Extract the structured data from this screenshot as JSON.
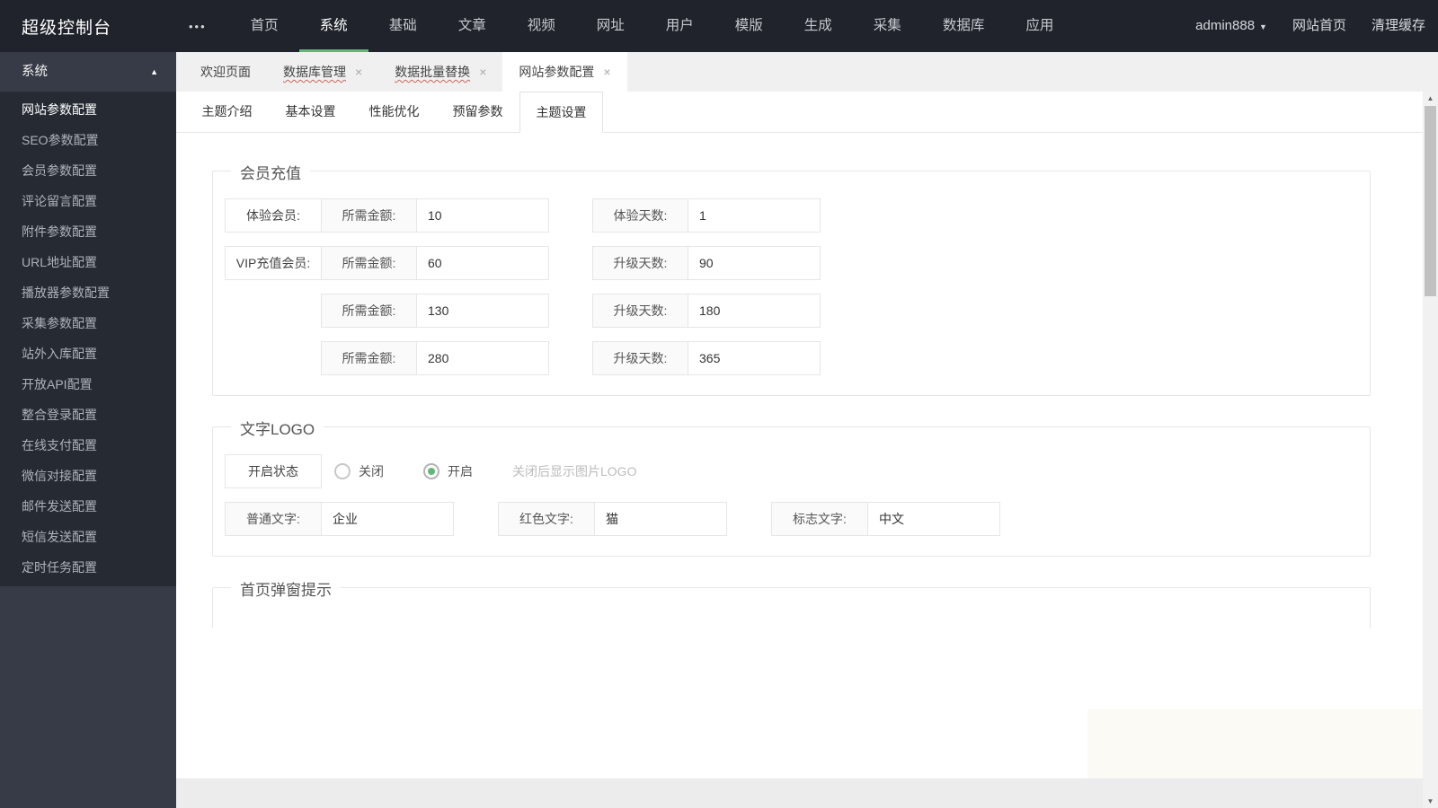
{
  "icons": {
    "more": "•••",
    "caret_down": "▼",
    "group_collapse": "▲",
    "close": "×",
    "scroll_up": "▲",
    "scroll_down": "▼"
  },
  "colors": {
    "accent_green": "#5FB878",
    "header_bg": "#20232b",
    "sidebar_bg": "#373b47",
    "sidebar_items_bg": "#262a33"
  },
  "header": {
    "brand": "超级控制台",
    "nav": [
      "首页",
      "系统",
      "基础",
      "文章",
      "视频",
      "网址",
      "用户",
      "模版",
      "生成",
      "采集",
      "数据库",
      "应用"
    ],
    "active_nav": "系统",
    "user": "admin888",
    "links": [
      "网站首页",
      "清理缓存"
    ]
  },
  "sidebar": {
    "group": "系统",
    "items": [
      "网站参数配置",
      "SEO参数配置",
      "会员参数配置",
      "评论留言配置",
      "附件参数配置",
      "URL地址配置",
      "播放器参数配置",
      "采集参数配置",
      "站外入库配置",
      "开放API配置",
      "整合登录配置",
      "在线支付配置",
      "微信对接配置",
      "邮件发送配置",
      "短信发送配置",
      "定时任务配置"
    ],
    "active_item": "网站参数配置"
  },
  "tabs": [
    {
      "label": "欢迎页面",
      "closable": false,
      "active": false
    },
    {
      "label": "数据库管理",
      "closable": true,
      "active": false
    },
    {
      "label": "数据批量替换",
      "closable": true,
      "active": false
    },
    {
      "label": "网站参数配置",
      "closable": true,
      "active": true
    }
  ],
  "subtabs": {
    "items": [
      "主题介绍",
      "基本设置",
      "性能优化",
      "预留参数",
      "主题设置"
    ],
    "active": "主题设置"
  },
  "sections": {
    "member": {
      "legend": "会员充值",
      "rows": [
        {
          "row_label": "体验会员:",
          "amount_label": "所需金额:",
          "amount": "10",
          "days_label": "体验天数:",
          "days": "1"
        },
        {
          "row_label": "VIP充值会员:",
          "amount_label": "所需金额:",
          "amount": "60",
          "days_label": "升级天数:",
          "days": "90"
        },
        {
          "row_label": "",
          "amount_label": "所需金额:",
          "amount": "130",
          "days_label": "升级天数:",
          "days": "180"
        },
        {
          "row_label": "",
          "amount_label": "所需金额:",
          "amount": "280",
          "days_label": "升级天数:",
          "days": "365"
        }
      ]
    },
    "logo": {
      "legend": "文字LOGO",
      "status_label": "开启状态",
      "radio_off": "关闭",
      "radio_on": "开启",
      "selected_radio": "开启",
      "hint": "关闭后显示图片LOGO",
      "fields": [
        {
          "label": "普通文字:",
          "value": "企业"
        },
        {
          "label": "红色文字:",
          "value": "猫"
        },
        {
          "label": "标志文字:",
          "value": "中文"
        }
      ]
    },
    "popup": {
      "legend": "首页弹窗提示"
    }
  }
}
